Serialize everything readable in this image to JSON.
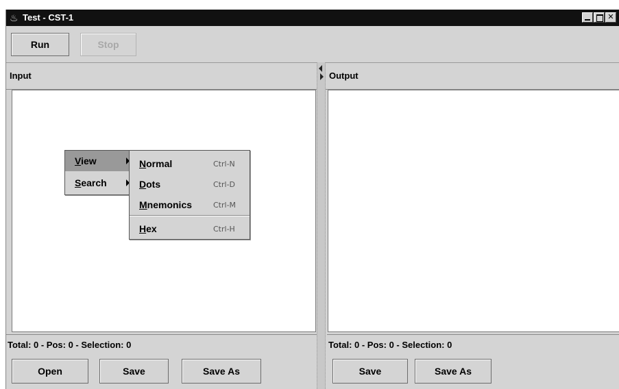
{
  "window": {
    "title": "Test - CST-1",
    "icon": "java-cup-icon"
  },
  "toolbar": {
    "run_label": "Run",
    "stop_label": "Stop"
  },
  "input_panel": {
    "header": "Input",
    "status": "Total: 0 - Pos: 0 - Selection: 0",
    "buttons": [
      "Open",
      "Save",
      "Save As"
    ]
  },
  "output_panel": {
    "header": "Output",
    "status": "Total: 0 - Pos: 0 - Selection: 0",
    "buttons": [
      "Save",
      "Save As"
    ]
  },
  "context_menu": {
    "items": [
      {
        "label": "View",
        "selected": true
      },
      {
        "label": "Search",
        "selected": false
      }
    ]
  },
  "view_submenu": {
    "items": [
      {
        "label": "Normal",
        "accelerator": "Ctrl-N"
      },
      {
        "label": "Dots",
        "accelerator": "Ctrl-D"
      },
      {
        "label": "Mnemonics",
        "accelerator": "Ctrl-M"
      },
      {
        "label": "Hex",
        "accelerator": "Ctrl-H"
      }
    ]
  }
}
